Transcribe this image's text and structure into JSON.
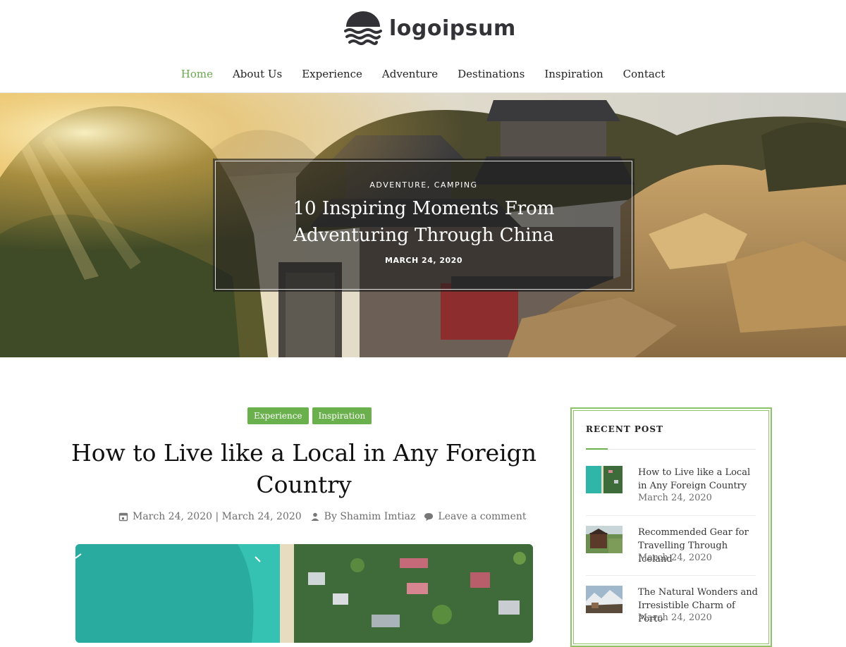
{
  "brand": {
    "name": "logoipsum"
  },
  "nav": {
    "items": [
      "Home",
      "About Us",
      "Experience",
      "Adventure",
      "Destinations",
      "Inspiration",
      "Contact"
    ],
    "active_index": 0,
    "active_color": "#6aa84f"
  },
  "hero": {
    "categories": "ADVENTURE, CAMPING",
    "title": "10 Inspiring Moments From Adventuring Through China",
    "date": "MARCH 24, 2020"
  },
  "post": {
    "tags": [
      "Experience",
      "Inspiration"
    ],
    "title": "How to Live like a Local in Any Foreign Country",
    "meta": {
      "date": "March 24, 2020 | March 24, 2020",
      "author": "By Shamim Imtiaz",
      "comments": "Leave a comment"
    }
  },
  "sidebar": {
    "heading": "RECENT POST",
    "posts": [
      {
        "title": "How to Live like a Local in Any Foreign Country",
        "date": "March 24, 2020"
      },
      {
        "title": "Recommended Gear for Travelling Through Iceland",
        "date": "March 24, 2020"
      },
      {
        "title": "The Natural Wonders and Irresistible Charm of Porto",
        "date": "March 24, 2020"
      }
    ]
  },
  "colors": {
    "accent": "#6ab04c",
    "sidebar_border": "#8fc36a",
    "text": "#1f1f1f",
    "muted": "#6d6d6d"
  }
}
